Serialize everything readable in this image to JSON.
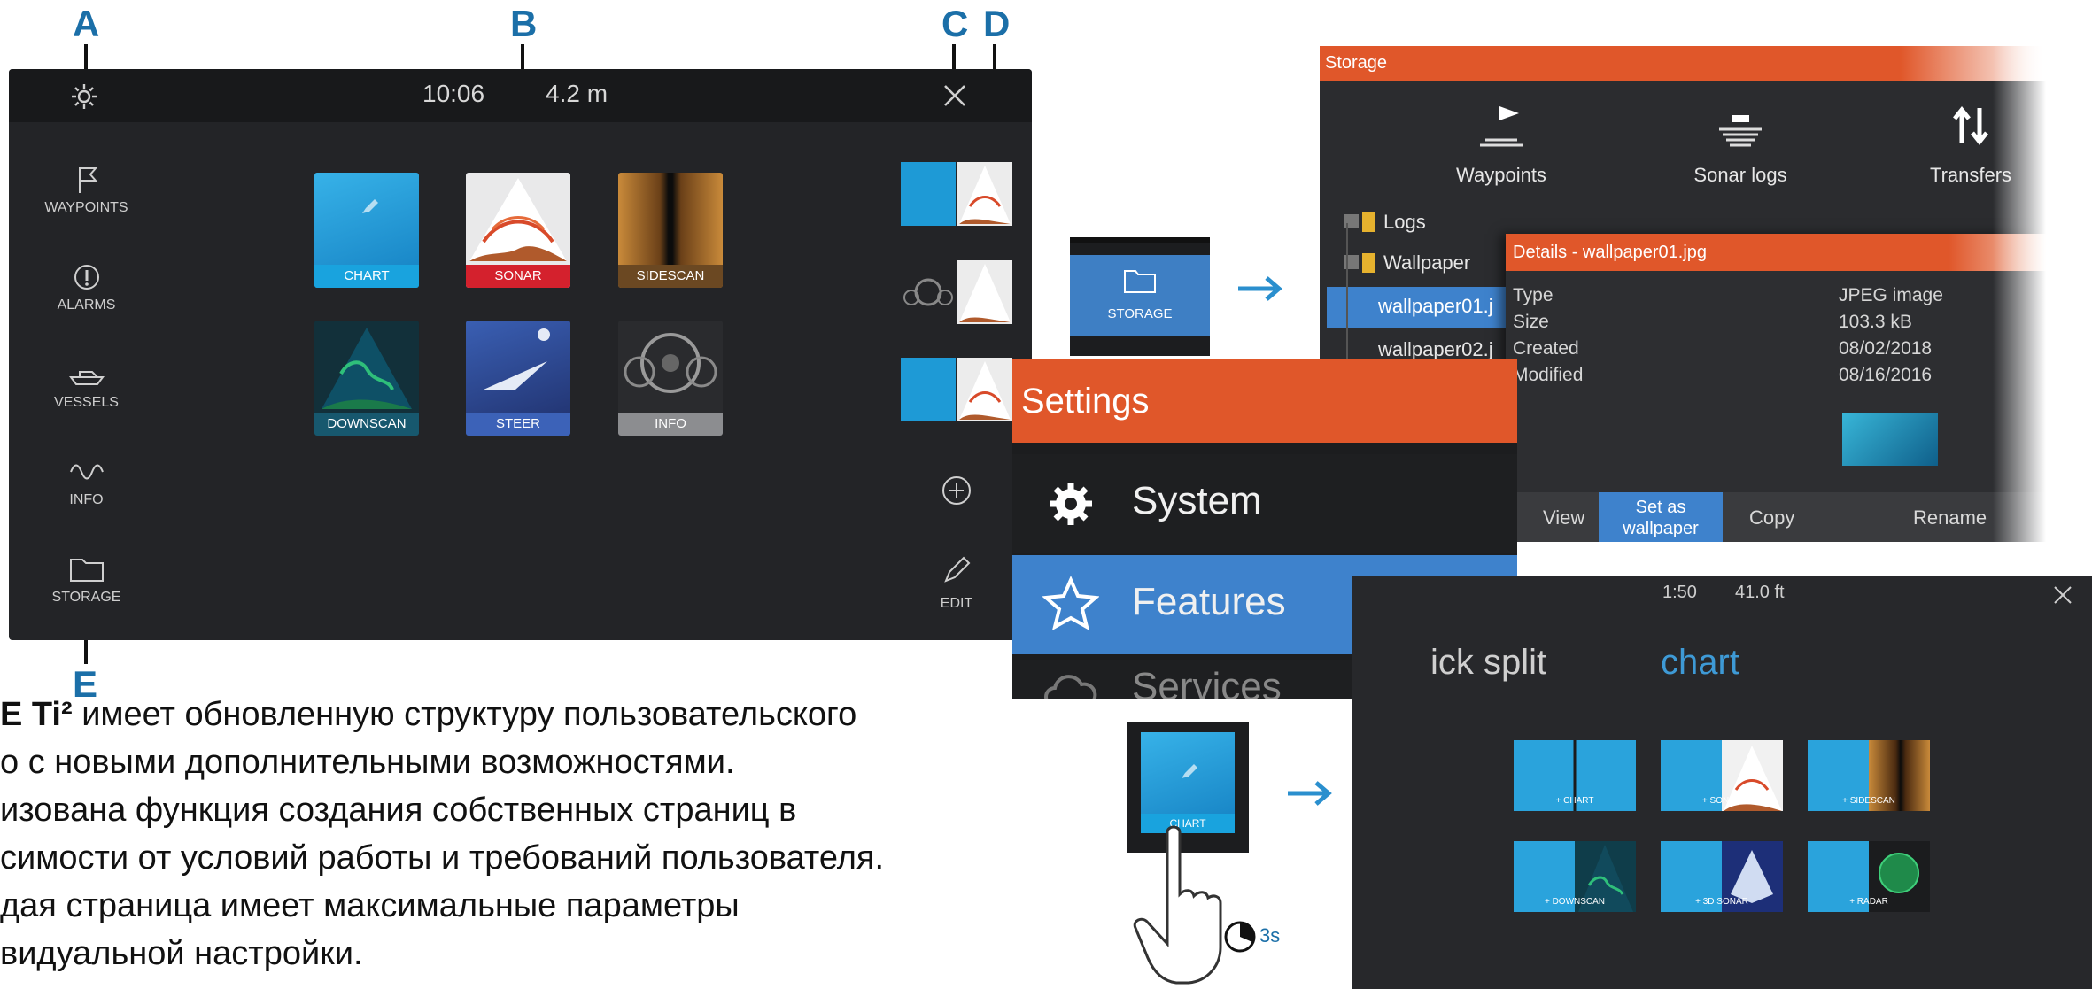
{
  "callouts": {
    "a": "A",
    "b": "B",
    "c": "C",
    "d": "D",
    "e": "E"
  },
  "home": {
    "time": "10:06",
    "depth": "4.2 m",
    "sidebar": [
      {
        "label": "WAYPOINTS",
        "icon": "flag-icon"
      },
      {
        "label": "ALARMS",
        "icon": "alarm-icon"
      },
      {
        "label": "VESSELS",
        "icon": "vessel-icon"
      },
      {
        "label": "INFO",
        "icon": "info-wave-icon"
      },
      {
        "label": "STORAGE",
        "icon": "folder-icon"
      }
    ],
    "apps": [
      {
        "label": "CHART",
        "color": "#1e9ad6"
      },
      {
        "label": "SONAR",
        "color": "#d6232f"
      },
      {
        "label": "SIDESCAN",
        "color": "#8a5a2a"
      },
      {
        "label": "DOWNSCAN",
        "color": "#1f6f8a"
      },
      {
        "label": "STEER",
        "color": "#3f63b5"
      },
      {
        "label": "INFO",
        "color": "#8c8d90"
      }
    ],
    "edit_label": "EDIT"
  },
  "storage": {
    "title": "Storage",
    "tabs": [
      {
        "label": "Waypoints",
        "icon": "waypoint-flag-icon"
      },
      {
        "label": "Sonar logs",
        "icon": "sonar-log-icon"
      },
      {
        "label": "Transfers",
        "icon": "transfer-arrows-icon"
      }
    ],
    "tree": [
      {
        "label": "Logs"
      },
      {
        "label": "Wallpaper"
      },
      {
        "label": "wallpaper01.j"
      },
      {
        "label": "wallpaper02.j"
      }
    ],
    "button_label": "STORAGE",
    "details": {
      "title": "Details - wallpaper01.jpg",
      "rows": [
        {
          "key": "Type",
          "value": "JPEG image"
        },
        {
          "key": "Size",
          "value": "103.3 kB"
        },
        {
          "key": "Created",
          "value": "08/02/2018"
        },
        {
          "key": "Modified",
          "value": "08/16/2016"
        }
      ],
      "actions": {
        "view": "View",
        "set_line1": "Set as",
        "set_line2": "wallpaper",
        "copy": "Copy",
        "rename": "Rename"
      }
    }
  },
  "settings": {
    "title": "Settings",
    "items": [
      {
        "label": "System",
        "icon": "gear-icon"
      },
      {
        "label": "Features",
        "icon": "star-icon"
      },
      {
        "label": "Services",
        "icon": "cloud-icon"
      }
    ]
  },
  "split": {
    "time": "1:50",
    "depth": "41.0 ft",
    "heading_grey": "ick split",
    "heading_blue": "chart",
    "chart_tile_label": "CHART",
    "hold_time": "3s",
    "options": [
      {
        "label": "+ CHART"
      },
      {
        "label": "+ SONAR"
      },
      {
        "label": "+ SIDESCAN"
      },
      {
        "label": "+ DOWNSCAN"
      },
      {
        "label": "+ 3D SONAR"
      },
      {
        "label": "+ RADAR"
      }
    ]
  },
  "text": {
    "line1_bold": "E Ti²",
    "line1": " имеет обновленную структуру пользовательского",
    "line2": "о с новыми дополнительными возможностями.",
    "line3": "изована функция создания собственных страниц  в",
    "line4": "симости от условий работы и требований пользователя.",
    "line5": "дая страница имеет максимальные параметры",
    "line6": "видуальной настройки."
  },
  "colors": {
    "accent": "#1b6fa8",
    "orange": "#e0572a",
    "blue": "#3e82cc",
    "dark": "#232427"
  }
}
